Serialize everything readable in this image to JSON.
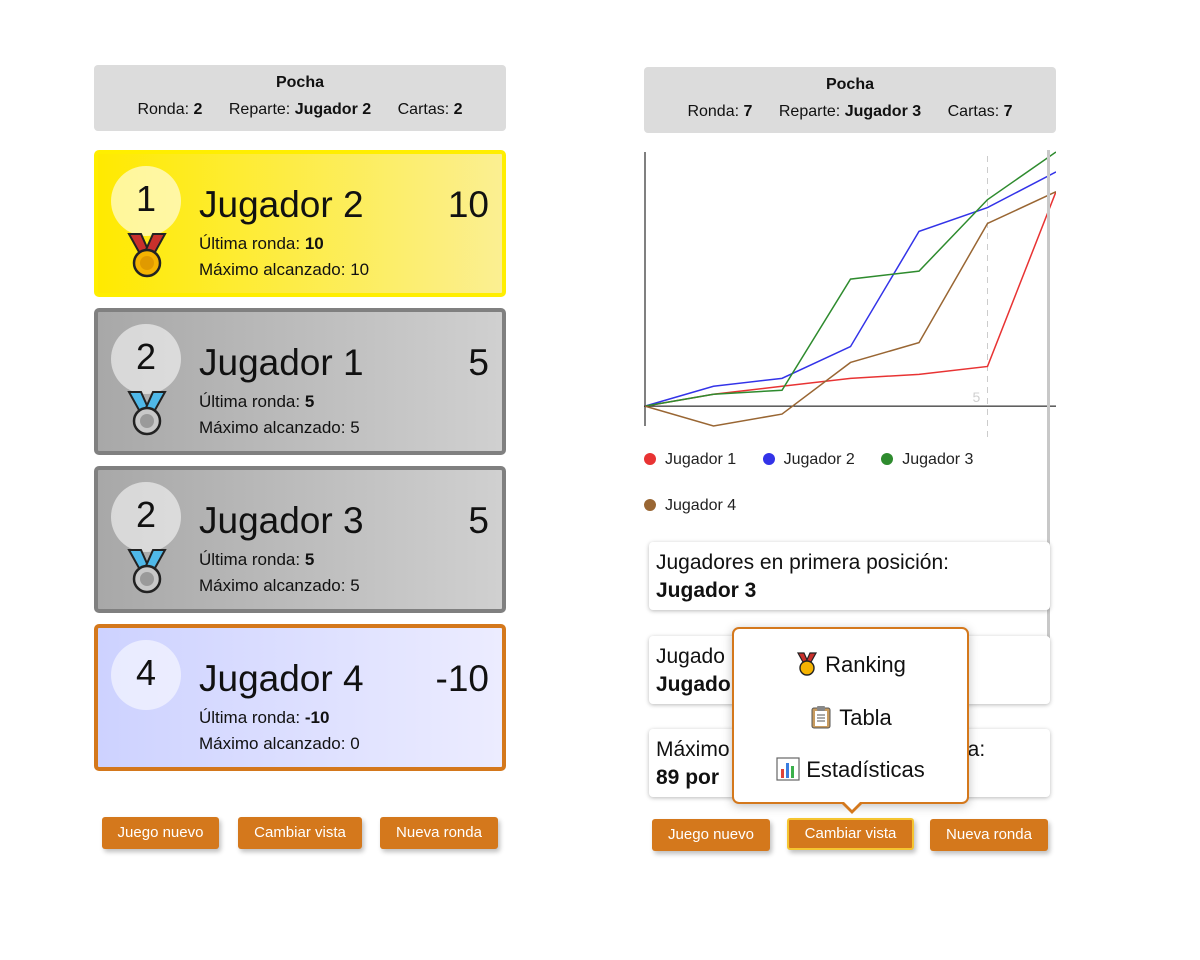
{
  "left": {
    "header": {
      "title": "Pocha",
      "round_label": "Ronda:",
      "round_value": "2",
      "dealer_label": "Reparte:",
      "dealer_value": "Jugador 2",
      "cards_label": "Cartas:",
      "cards_value": "2"
    },
    "ranking": [
      {
        "position": "1",
        "name": "Jugador 2",
        "score": "10",
        "last_label": "Última ronda:",
        "last_value": "10",
        "max_label": "Máximo alcanzado:",
        "max_value": "10",
        "medal": "gold-medal-icon"
      },
      {
        "position": "2",
        "name": "Jugador 1",
        "score": "5",
        "last_label": "Última ronda:",
        "last_value": "5",
        "max_label": "Máximo alcanzado:",
        "max_value": "5",
        "medal": "silver-medal-icon"
      },
      {
        "position": "2",
        "name": "Jugador 3",
        "score": "5",
        "last_label": "Última ronda:",
        "last_value": "5",
        "max_label": "Máximo alcanzado:",
        "max_value": "5",
        "medal": "silver-medal-icon"
      },
      {
        "position": "4",
        "name": "Jugador 4",
        "score": "-10",
        "last_label": "Última ronda:",
        "last_value": "-10",
        "max_label": "Máximo alcanzado:",
        "max_value": "0",
        "medal": ""
      }
    ],
    "buttons": {
      "new_game": "Juego nuevo",
      "change_view": "Cambiar vista",
      "new_round": "Nueva ronda"
    }
  },
  "right": {
    "header": {
      "title": "Pocha",
      "round_label": "Ronda:",
      "round_value": "7",
      "dealer_label": "Reparte:",
      "dealer_value": "Jugador 3",
      "cards_label": "Cartas:",
      "cards_value": "7"
    },
    "stats": [
      {
        "label": "Jugadores en primera posición:",
        "value": "Jugador 3"
      },
      {
        "label": "Jugado",
        "value": "Jugado"
      },
      {
        "label_left": "Máximo",
        "label_right": "da:",
        "value": "89 por"
      }
    ],
    "menu": [
      {
        "label": "Ranking",
        "icon": "medal-icon"
      },
      {
        "label": "Tabla",
        "icon": "clipboard-icon"
      },
      {
        "label": "Estadísticas",
        "icon": "bar-chart-icon"
      }
    ],
    "buttons": {
      "new_game": "Juego nuevo",
      "change_view": "Cambiar vista",
      "new_round": "Nueva ronda"
    }
  },
  "chart_data": {
    "type": "line",
    "x": [
      0,
      1,
      2,
      3,
      4,
      5,
      6
    ],
    "x_marker": {
      "value": 5,
      "label": "5"
    },
    "series": [
      {
        "name": "Jugador 1",
        "color": "#e83333",
        "values": [
          0,
          3,
          5,
          7,
          8,
          10,
          54
        ]
      },
      {
        "name": "Jugador 2",
        "color": "#3333e8",
        "values": [
          0,
          5,
          7,
          15,
          44,
          50,
          59
        ]
      },
      {
        "name": "Jugador 3",
        "color": "#2e8b2e",
        "values": [
          0,
          3,
          4,
          32,
          34,
          52,
          64
        ]
      },
      {
        "name": "Jugador 4",
        "color": "#996633",
        "values": [
          0,
          -5,
          -2,
          11,
          16,
          46,
          54
        ]
      }
    ],
    "ylim": [
      -5,
      64
    ],
    "legend_position": "bottom",
    "grid": false
  }
}
